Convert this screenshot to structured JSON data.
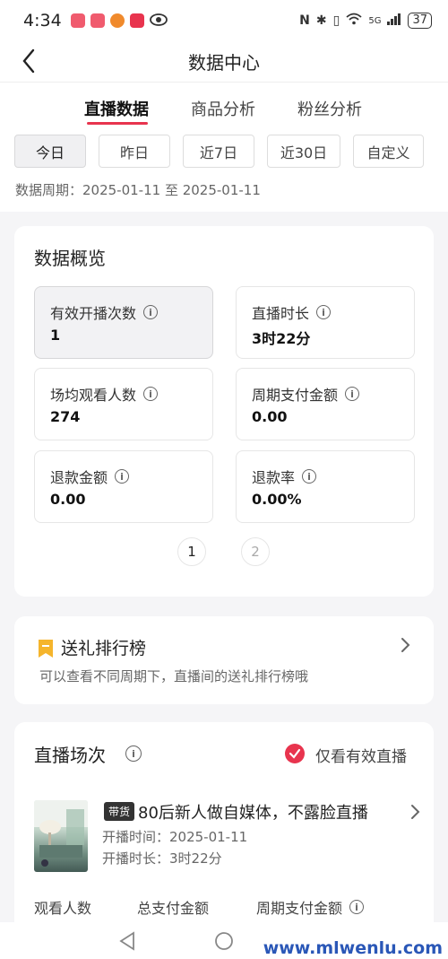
{
  "status": {
    "time": "4:34",
    "network": "5G",
    "battery": "37"
  },
  "nav": {
    "title": "数据中心"
  },
  "tabs": [
    {
      "label": "直播数据",
      "active": true
    },
    {
      "label": "商品分析",
      "active": false
    },
    {
      "label": "粉丝分析",
      "active": false
    }
  ],
  "ranges": [
    {
      "label": "今日",
      "active": true
    },
    {
      "label": "昨日",
      "active": false
    },
    {
      "label": "近7日",
      "active": false
    },
    {
      "label": "近30日",
      "active": false
    },
    {
      "label": "自定义",
      "active": false
    }
  ],
  "period": "数据周期：2025-01-11 至 2025-01-11",
  "overview": {
    "title": "数据概览",
    "metrics": [
      {
        "label": "有效开播次数",
        "value": "1"
      },
      {
        "label": "直播时长",
        "value": "3时22分"
      },
      {
        "label": "场均观看人数",
        "value": "274"
      },
      {
        "label": "周期支付金额",
        "value": "0.00"
      },
      {
        "label": "退款金额",
        "value": "0.00"
      },
      {
        "label": "退款率",
        "value": "0.00%"
      }
    ],
    "pages": [
      "1",
      "2"
    ]
  },
  "gift": {
    "title": "送礼排行榜",
    "subtitle": "可以查看不同周期下，直播间的送礼排行榜哦"
  },
  "sessions": {
    "title": "直播场次",
    "only_valid_label": "仅看有效直播",
    "item": {
      "tag": "带货",
      "title": "80后新人做自媒体，不露脸直播",
      "start_time": "开播时间：2025-01-11",
      "duration": "开播时长：3时22分"
    },
    "stat_labels": [
      "观看人数",
      "总支付金额",
      "周期支付金额"
    ]
  },
  "watermark": "www.mlwenlu.com",
  "colors": {
    "accent": "#e8344e",
    "gift_icon": "#f5b52c"
  }
}
